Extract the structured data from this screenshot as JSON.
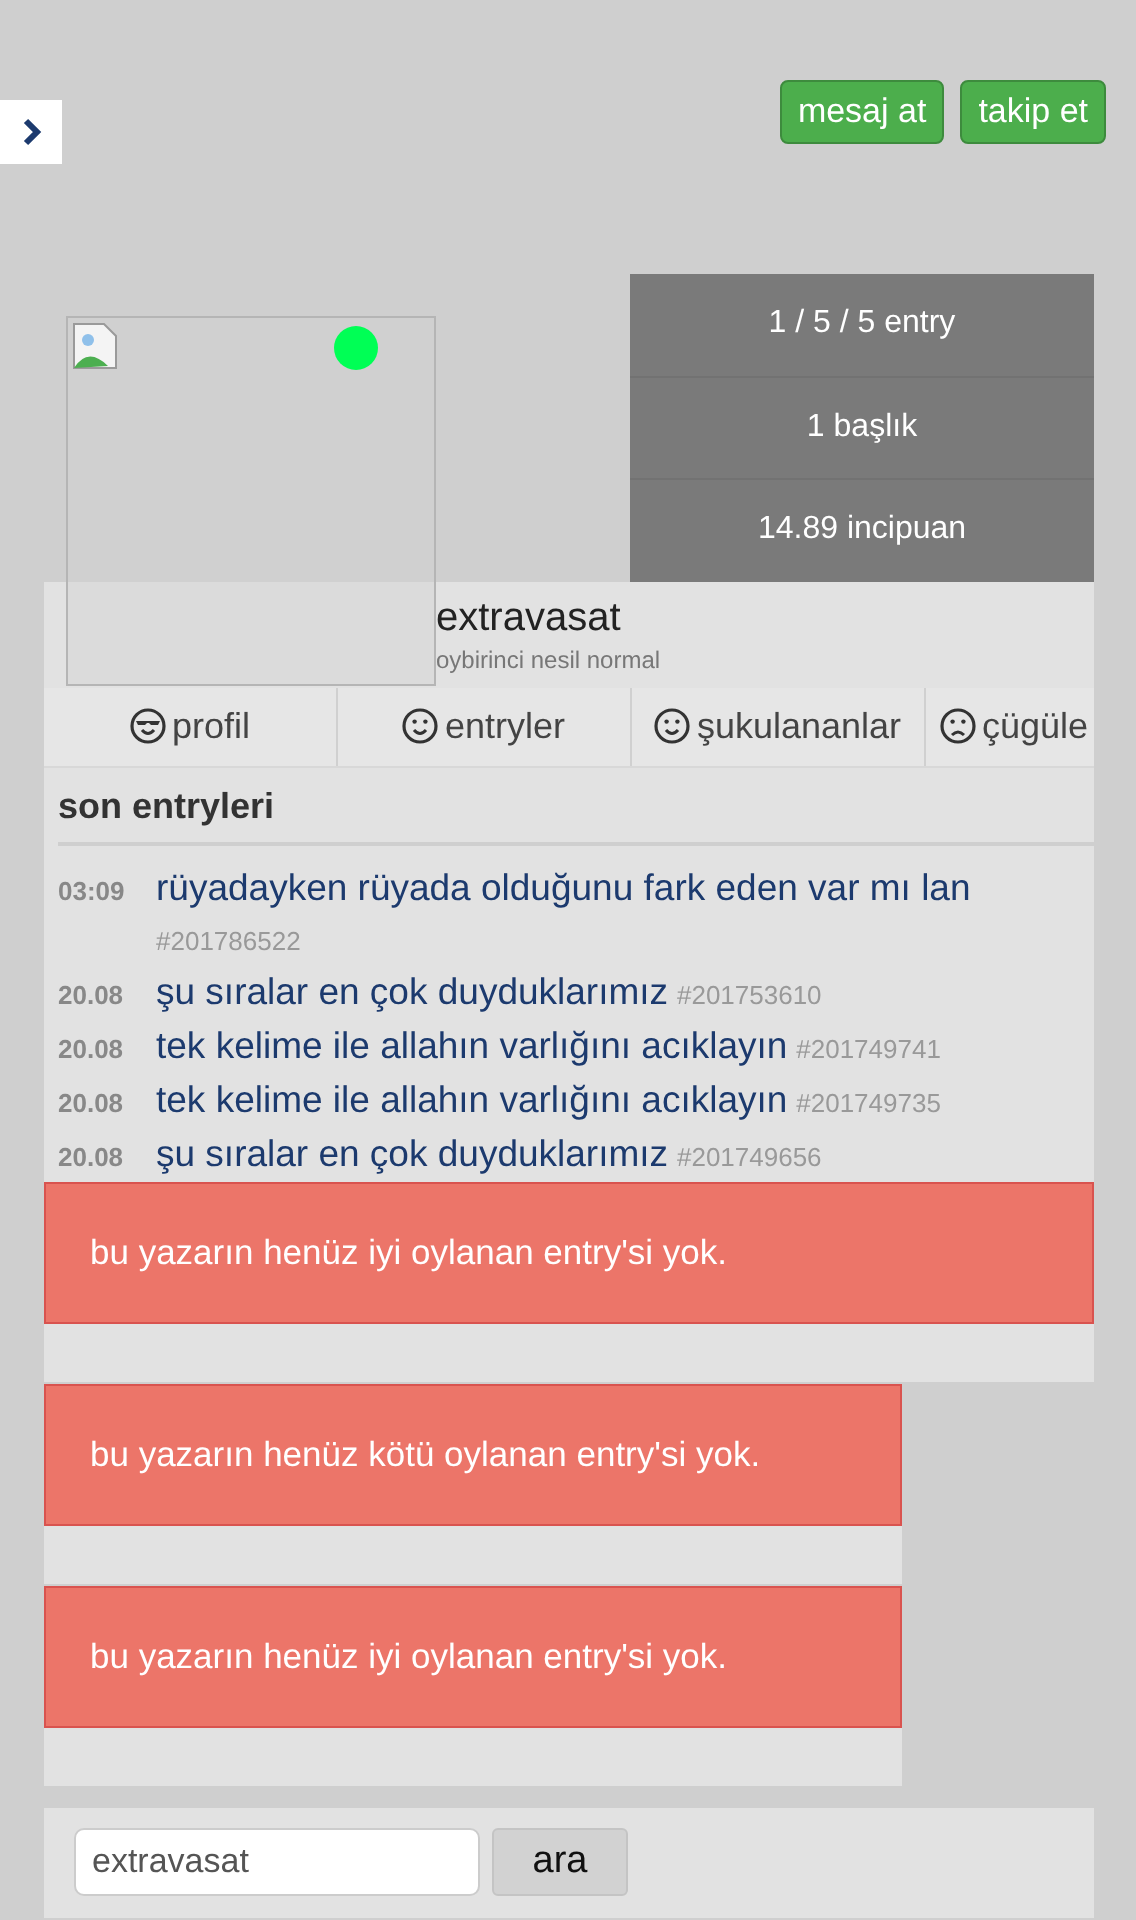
{
  "actions": [
    {
      "label": "mesaj at"
    },
    {
      "label": "takip et"
    }
  ],
  "stats": [
    "1 / 5 / 5 entry",
    "1 başlık",
    "14.89 incipuan"
  ],
  "profile": {
    "name": "extravasat",
    "subtitle": "oybirinci nesil normal",
    "online": true
  },
  "tabs": [
    {
      "kind": "cool",
      "label": "profil"
    },
    {
      "kind": "happy",
      "label": "entryler"
    },
    {
      "kind": "happy",
      "label": "şukulananlar"
    },
    {
      "kind": "sad",
      "label": "çügüle"
    }
  ],
  "recent": {
    "heading": "son entryleri",
    "entries": [
      {
        "time": "03:09",
        "title": "rüyadayken rüyada olduğunu fark eden var mı lan",
        "id": "#201786522"
      },
      {
        "time": "20.08",
        "title": "şu sıralar en çok duyduklarımız",
        "id": "#201753610"
      },
      {
        "time": "20.08",
        "title": "tek kelime ile allahın varlığını acıklayın",
        "id": "#201749741"
      },
      {
        "time": "20.08",
        "title": "tek kelime ile allahın varlığını acıklayın",
        "id": "#201749735"
      },
      {
        "time": "20.08",
        "title": "şu sıralar en çok duyduklarımız",
        "id": "#201749656"
      }
    ]
  },
  "notices": [
    {
      "text": "bu yazarın henüz iyi oylanan entry'si yok.",
      "wide": true
    },
    {
      "text": "bu yazarın henüz kötü oylanan entry'si yok.",
      "wide": false
    },
    {
      "text": "bu yazarın henüz iyi oylanan entry'si yok.",
      "wide": false
    }
  ],
  "search": {
    "value": "extravasat",
    "button": "ara"
  }
}
